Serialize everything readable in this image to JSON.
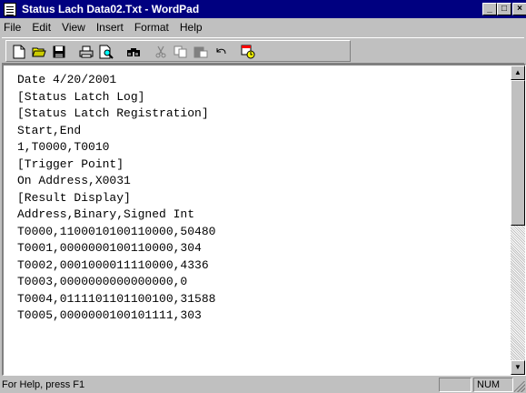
{
  "window": {
    "title": "Status Lach Data02.Txt - WordPad"
  },
  "titlebar_buttons": {
    "minimize": "_",
    "maximize": "□",
    "close": "×"
  },
  "menu": [
    "File",
    "Edit",
    "View",
    "Insert",
    "Format",
    "Help"
  ],
  "toolbar": {
    "icons": [
      "new-icon",
      "open-icon",
      "save-icon",
      "print-icon",
      "print-preview-icon",
      "find-icon",
      "cut-icon",
      "copy-icon",
      "paste-icon",
      "undo-icon",
      "date-time-icon"
    ]
  },
  "document": {
    "lines": [
      "Date 4/20/2001",
      "[Status Latch Log]",
      "[Status Latch Registration]",
      "Start,End",
      "1,T0000,T0010",
      "[Trigger Point]",
      "On Address,X0031",
      "[Result Display]",
      "Address,Binary,Signed Int",
      "T0000,1100010100110000,50480",
      "T0001,0000000100110000,304",
      "T0002,0001000011110000,4336",
      "T0003,0000000000000000,0",
      "T0004,0111101101100100,31588",
      "T0005,0000000100101111,303"
    ]
  },
  "status": {
    "help_text": "For Help, press F1",
    "num_indicator": "NUM"
  }
}
